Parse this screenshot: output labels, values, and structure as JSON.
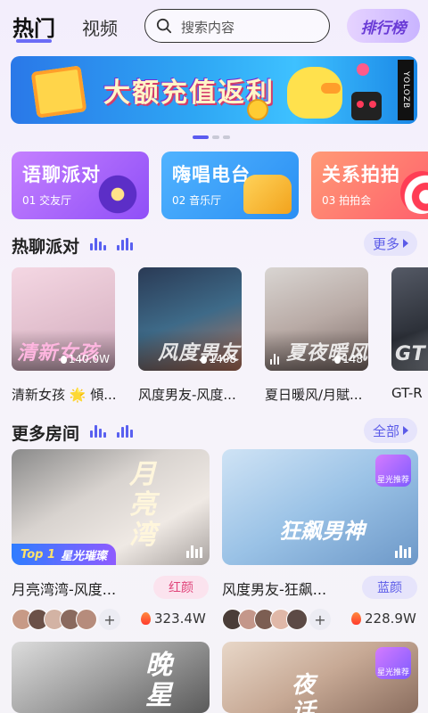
{
  "header": {
    "tab_hot": "热门",
    "tab_video": "视频",
    "search_placeholder": "搜索内容",
    "rank_label": "排行榜"
  },
  "banner": {
    "title": "大额充值返利",
    "brand": "YOLOZB",
    "page_index": 1,
    "page_count": 3
  },
  "categories": [
    {
      "title": "语聊派对",
      "sub": "01 交友厅"
    },
    {
      "title": "嗨唱电台",
      "sub": "02 音乐厅"
    },
    {
      "title": "关系拍拍",
      "sub": "03 拍拍会"
    }
  ],
  "hot_section": {
    "title": "热聊派对",
    "more_label": "更多",
    "cards": [
      {
        "name": "清新女孩 🌟 傾...",
        "art_text": "清新女孩",
        "count": "140.0W"
      },
      {
        "name": "风度男友-风度...",
        "art_text": "风度男友",
        "count": "1408"
      },
      {
        "name": "夏日暖风/月賦...",
        "art_text": "夏夜暖风",
        "count": "148"
      },
      {
        "name": "GT-R",
        "art_text": "GT",
        "count": ""
      }
    ]
  },
  "rooms_section": {
    "title": "更多房间",
    "all_label": "全部",
    "rooms": [
      {
        "name": "月亮湾湾-风度...",
        "tag": "红颜",
        "heat": "323.4W",
        "art_text": "月亮湾",
        "top_badge": "星光璀璨",
        "top_rank": "Top 1"
      },
      {
        "name": "风度男友-狂飙...",
        "tag": "蓝颜",
        "heat": "228.9W",
        "art_text": "狂飙男神",
        "corner": "星光推荐"
      },
      {
        "name": "",
        "art_text": "晚星"
      },
      {
        "name": "",
        "art_text": "夜话",
        "corner": "星光推荐"
      }
    ]
  },
  "colors": {
    "accent": "#5b5bf0",
    "rank_text": "#6a3bd6",
    "tag_red_bg": "#fbe3ee",
    "tag_red_text": "#e0447a",
    "tag_blue_bg": "#e6e4fb",
    "tag_blue_text": "#5b5be8"
  }
}
